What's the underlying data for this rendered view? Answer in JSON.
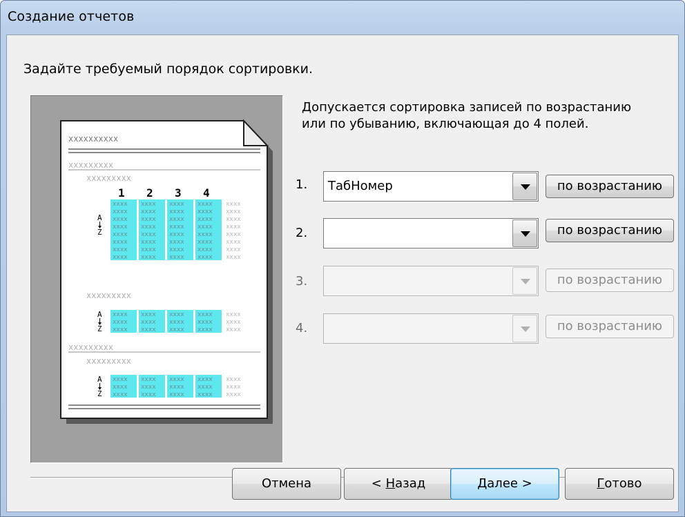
{
  "window": {
    "title": "Создание отчетов"
  },
  "prompt": "Задайте требуемый порядок сортировки.",
  "description": {
    "line1": "Допускается сортировка записей по возрастанию",
    "line2": "или по убыванию, включающая до 4 полей."
  },
  "preview": {
    "placeholder_long": "xxxxxxxxxx",
    "placeholder_group": "xxxxxxxxx",
    "placeholder_cell": "xxxx",
    "column_numbers": [
      "1",
      "2",
      "3",
      "4"
    ],
    "sort_glyph_top": "A",
    "sort_glyph_bottom": "Z",
    "highlight_color": "#5ce8ee",
    "paper_color": "#ffffff",
    "background_color": "#a0a0a0"
  },
  "sort_fields": [
    {
      "number": "1.",
      "value": "ТабНомер",
      "order_label": "по возрастанию",
      "enabled": true
    },
    {
      "number": "2.",
      "value": "",
      "order_label": "по возрастанию",
      "enabled": true
    },
    {
      "number": "3.",
      "value": "",
      "order_label": "по возрастанию",
      "enabled": false
    },
    {
      "number": "4.",
      "value": "",
      "order_label": "по возрастанию",
      "enabled": false
    }
  ],
  "buttons": {
    "cancel": "Отмена",
    "back_prefix": "< ",
    "back_accel": "Н",
    "back_rest": "азад",
    "next_accel": "Д",
    "next_rest": "алее >",
    "finish_accel": "Г",
    "finish_rest": "отово"
  }
}
